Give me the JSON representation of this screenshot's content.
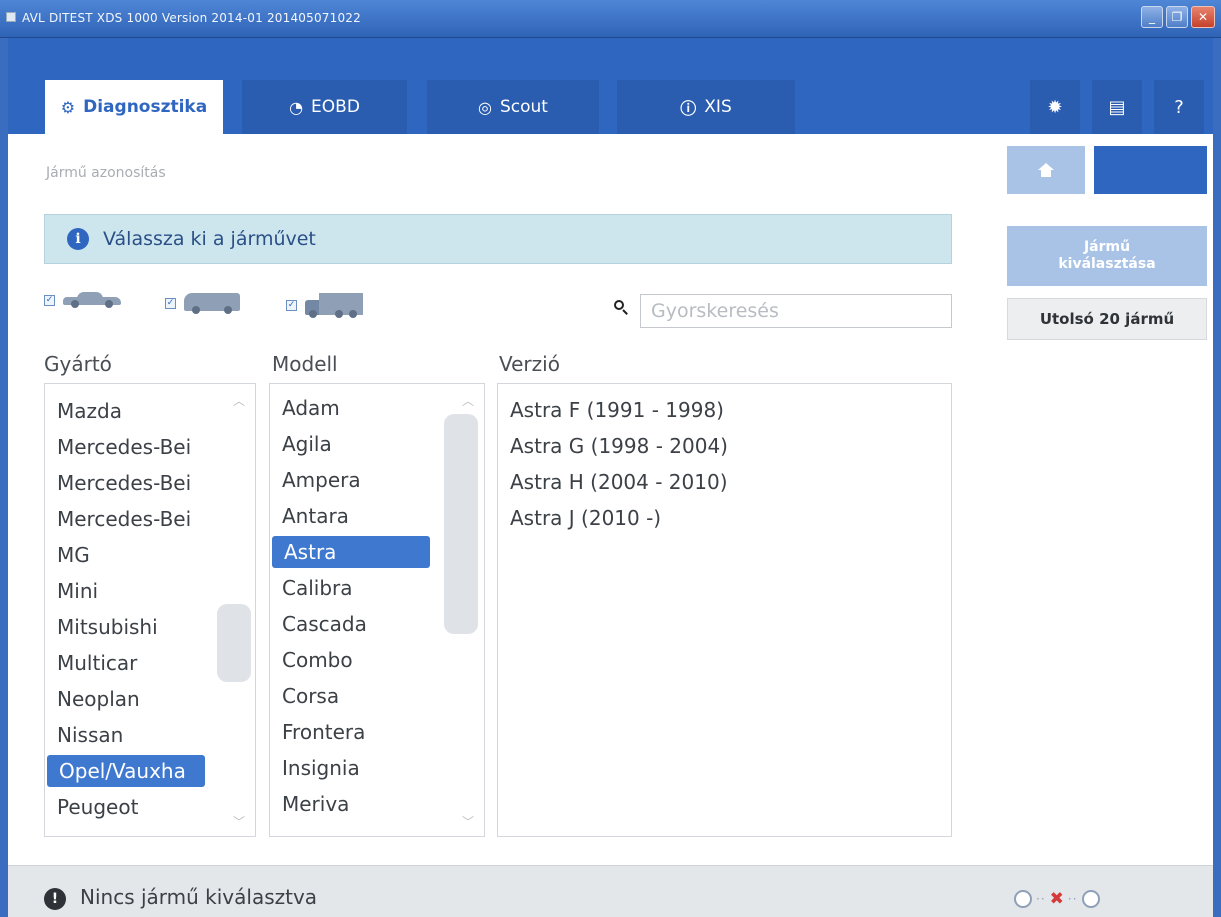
{
  "window": {
    "title": "AVL DITEST XDS 1000 Version 2014-01  201405071022"
  },
  "tabs": [
    {
      "label": "Diagnosztika",
      "icon": "wrench-search-icon",
      "active": true
    },
    {
      "label": "EOBD",
      "icon": "eobd-icon",
      "active": false
    },
    {
      "label": "Scout",
      "icon": "scout-icon",
      "active": false
    },
    {
      "label": "XIS",
      "icon": "info-icon",
      "active": false
    }
  ],
  "header_buttons": {
    "settings": "gear-icon",
    "messages": "chat-icon",
    "help": "?"
  },
  "breadcrumb": "Jármű azonosítás",
  "banner": {
    "icon": "i",
    "text": "Válassza ki a járművet"
  },
  "vehicle_types": [
    {
      "type": "car",
      "checked": true
    },
    {
      "type": "van",
      "checked": true
    },
    {
      "type": "truck",
      "checked": true
    }
  ],
  "search": {
    "placeholder": "Gyorskeresés",
    "value": ""
  },
  "columns": {
    "manufacturer": "Gyártó",
    "model": "Modell",
    "version": "Verzió"
  },
  "manufacturers": [
    "Mazda",
    "Mercedes-Bei",
    "Mercedes-Bei",
    "Mercedes-Bei",
    "MG",
    "Mini",
    "Mitsubishi",
    "Multicar",
    "Neoplan",
    "Nissan",
    "Opel/Vauxha",
    "Peugeot"
  ],
  "selected_manufacturer": "Opel/Vauxha",
  "models": [
    "Adam",
    "Agila",
    "Ampera",
    "Antara",
    "Astra",
    "Calibra",
    "Cascada",
    "Combo",
    "Corsa",
    "Frontera",
    "Insignia",
    "Meriva"
  ],
  "selected_model": "Astra",
  "versions": [
    "Astra F (1991 - 1998)",
    "Astra G (1998 - 2004)",
    "Astra H (2004 - 2010)",
    "Astra J (2010 -)"
  ],
  "side": {
    "vehicle_select_line1": "Jármű",
    "vehicle_select_line2": "kiválasztása",
    "last20": "Utolsó 20 jármű"
  },
  "status": {
    "icon": "!",
    "text": "Nincs jármű kiválasztva",
    "connection": "disconnected"
  },
  "colors": {
    "accent": "#2f66c0",
    "banner": "#cde6ee",
    "selection": "#3f78cf",
    "disconnect": "#d43a3a"
  }
}
